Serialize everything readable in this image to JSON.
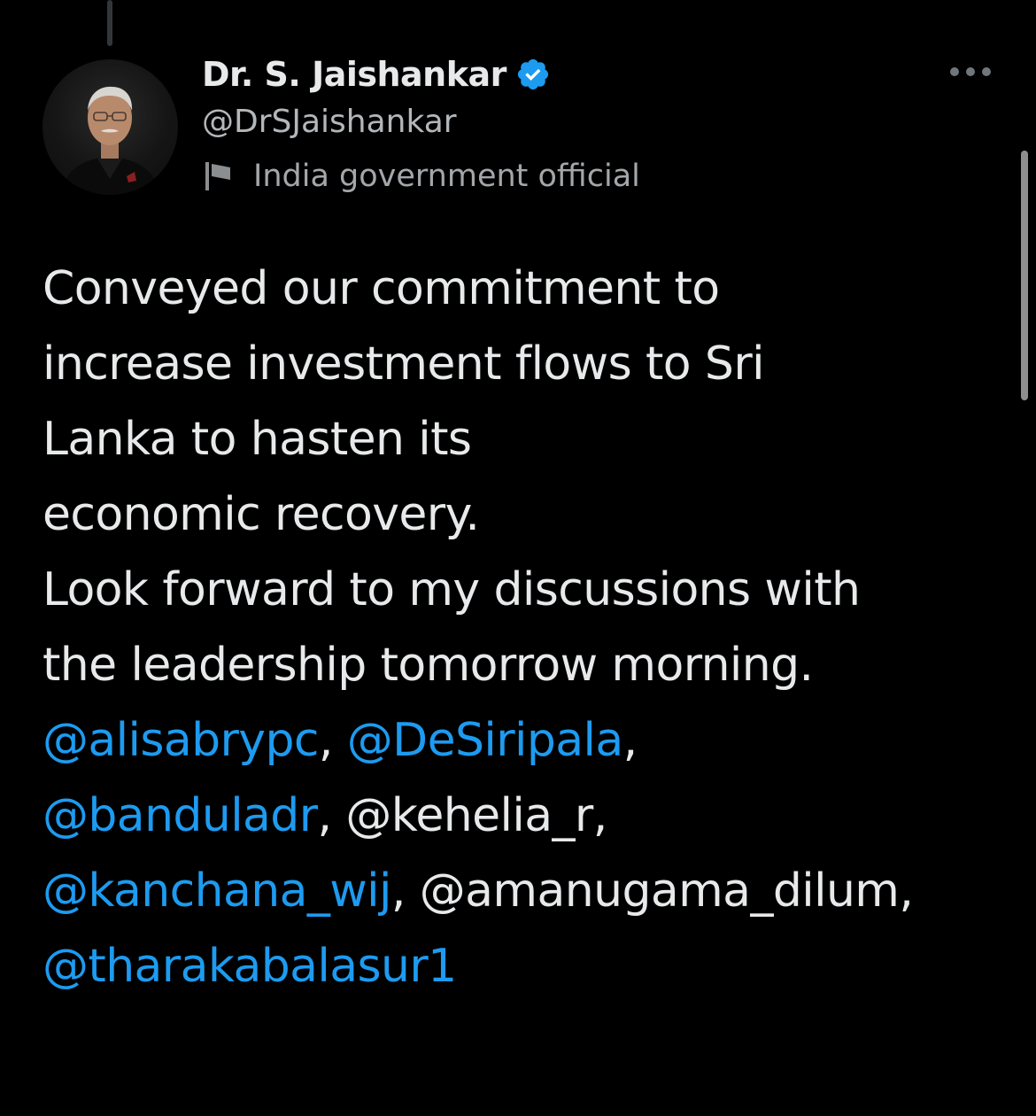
{
  "tweet": {
    "display_name": "Dr. S. Jaishankar",
    "handle": "@DrSJaishankar",
    "affiliation_label": "India government official",
    "verified": true,
    "body": {
      "paragraph_1_lines": [
        "Conveyed our commitment to",
        "increase investment flows to Sri",
        "Lanka to hasten its",
        "economic recovery."
      ],
      "paragraph_2_lines": [
        "Look forward to my discussions with",
        "the leadership tomorrow morning."
      ],
      "mentions": [
        {
          "text": "@alisabrypc",
          "linked": true
        },
        {
          "text": "@DeSiripala",
          "linked": true
        },
        {
          "text": "@banduladr",
          "linked": true
        },
        {
          "text": "@kehelia_r",
          "linked": false
        },
        {
          "text": "@kanchana_wij",
          "linked": true
        },
        {
          "text": "@amanugama_dilum",
          "linked": false
        },
        {
          "text": "@tharakabalasur1",
          "linked": true
        }
      ],
      "separator": ", "
    }
  },
  "icons": {
    "verified": "verified-badge-icon",
    "affiliation": "flag-icon",
    "more": "more-options-icon"
  },
  "colors": {
    "background": "#000000",
    "text": "#e7e9ea",
    "secondary_text": "#71767b",
    "link": "#1d9bf0",
    "verified": "#1d9bf0"
  }
}
